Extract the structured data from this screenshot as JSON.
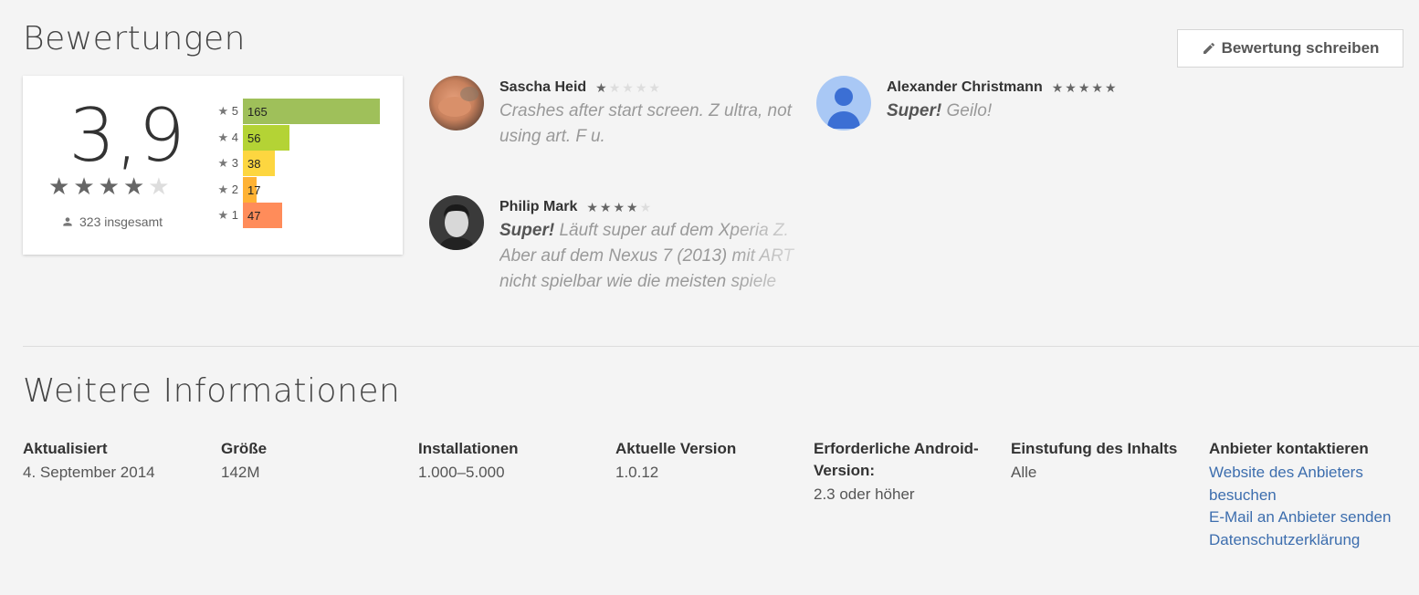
{
  "reviews": {
    "title": "Bewertungen",
    "write_button": "Bewertung schreiben",
    "average": "3,9",
    "average_stars": 4,
    "total": "323 insgesamt",
    "histogram": [
      {
        "stars": "5",
        "count": "165",
        "value": 165,
        "color": "#9fc05a"
      },
      {
        "stars": "4",
        "count": "56",
        "value": 56,
        "color": "#b4d335"
      },
      {
        "stars": "3",
        "count": "38",
        "value": 38,
        "color": "#fdd640"
      },
      {
        "stars": "2",
        "count": "17",
        "value": 17,
        "color": "#ffb234"
      },
      {
        "stars": "1",
        "count": "47",
        "value": 47,
        "color": "#ff8c5a"
      }
    ],
    "items": [
      {
        "name": "Sascha Heid",
        "rating": 1,
        "bold": "",
        "text": "Crashes after start screen. Z ultra, not using art. F u."
      },
      {
        "name": "Alexander Christmann",
        "rating": 5,
        "bold": "Super!",
        "text": "Geilo!"
      },
      {
        "name": "Philip Mark",
        "rating": 4,
        "bold": "Super!",
        "text": "Läuft super auf dem Xperia Z. Aber auf dem Nexus 7 (2013) mit ART nicht spielbar wie die meisten spiele"
      }
    ]
  },
  "info": {
    "title": "Weitere Informationen",
    "updated": {
      "label": "Aktualisiert",
      "value": "4. September 2014"
    },
    "size": {
      "label": "Größe",
      "value": "142M"
    },
    "installs": {
      "label": "Installationen",
      "value": "1.000–5.000"
    },
    "version": {
      "label": "Aktuelle Version",
      "value": "1.0.12"
    },
    "android": {
      "label": "Erforderliche Android-Version:",
      "value": "2.3 oder höher"
    },
    "rating": {
      "label": "Einstufung des Inhalts",
      "value": "Alle"
    },
    "contact": {
      "label": "Anbieter kontaktieren",
      "website": "Website des Anbieters besuchen",
      "email": "E-Mail an Anbieter senden",
      "privacy": "Datenschutzerklärung"
    }
  },
  "colors": {
    "star_filled": "#666666",
    "star_empty": "#dddddd",
    "link": "#3d6eae"
  }
}
